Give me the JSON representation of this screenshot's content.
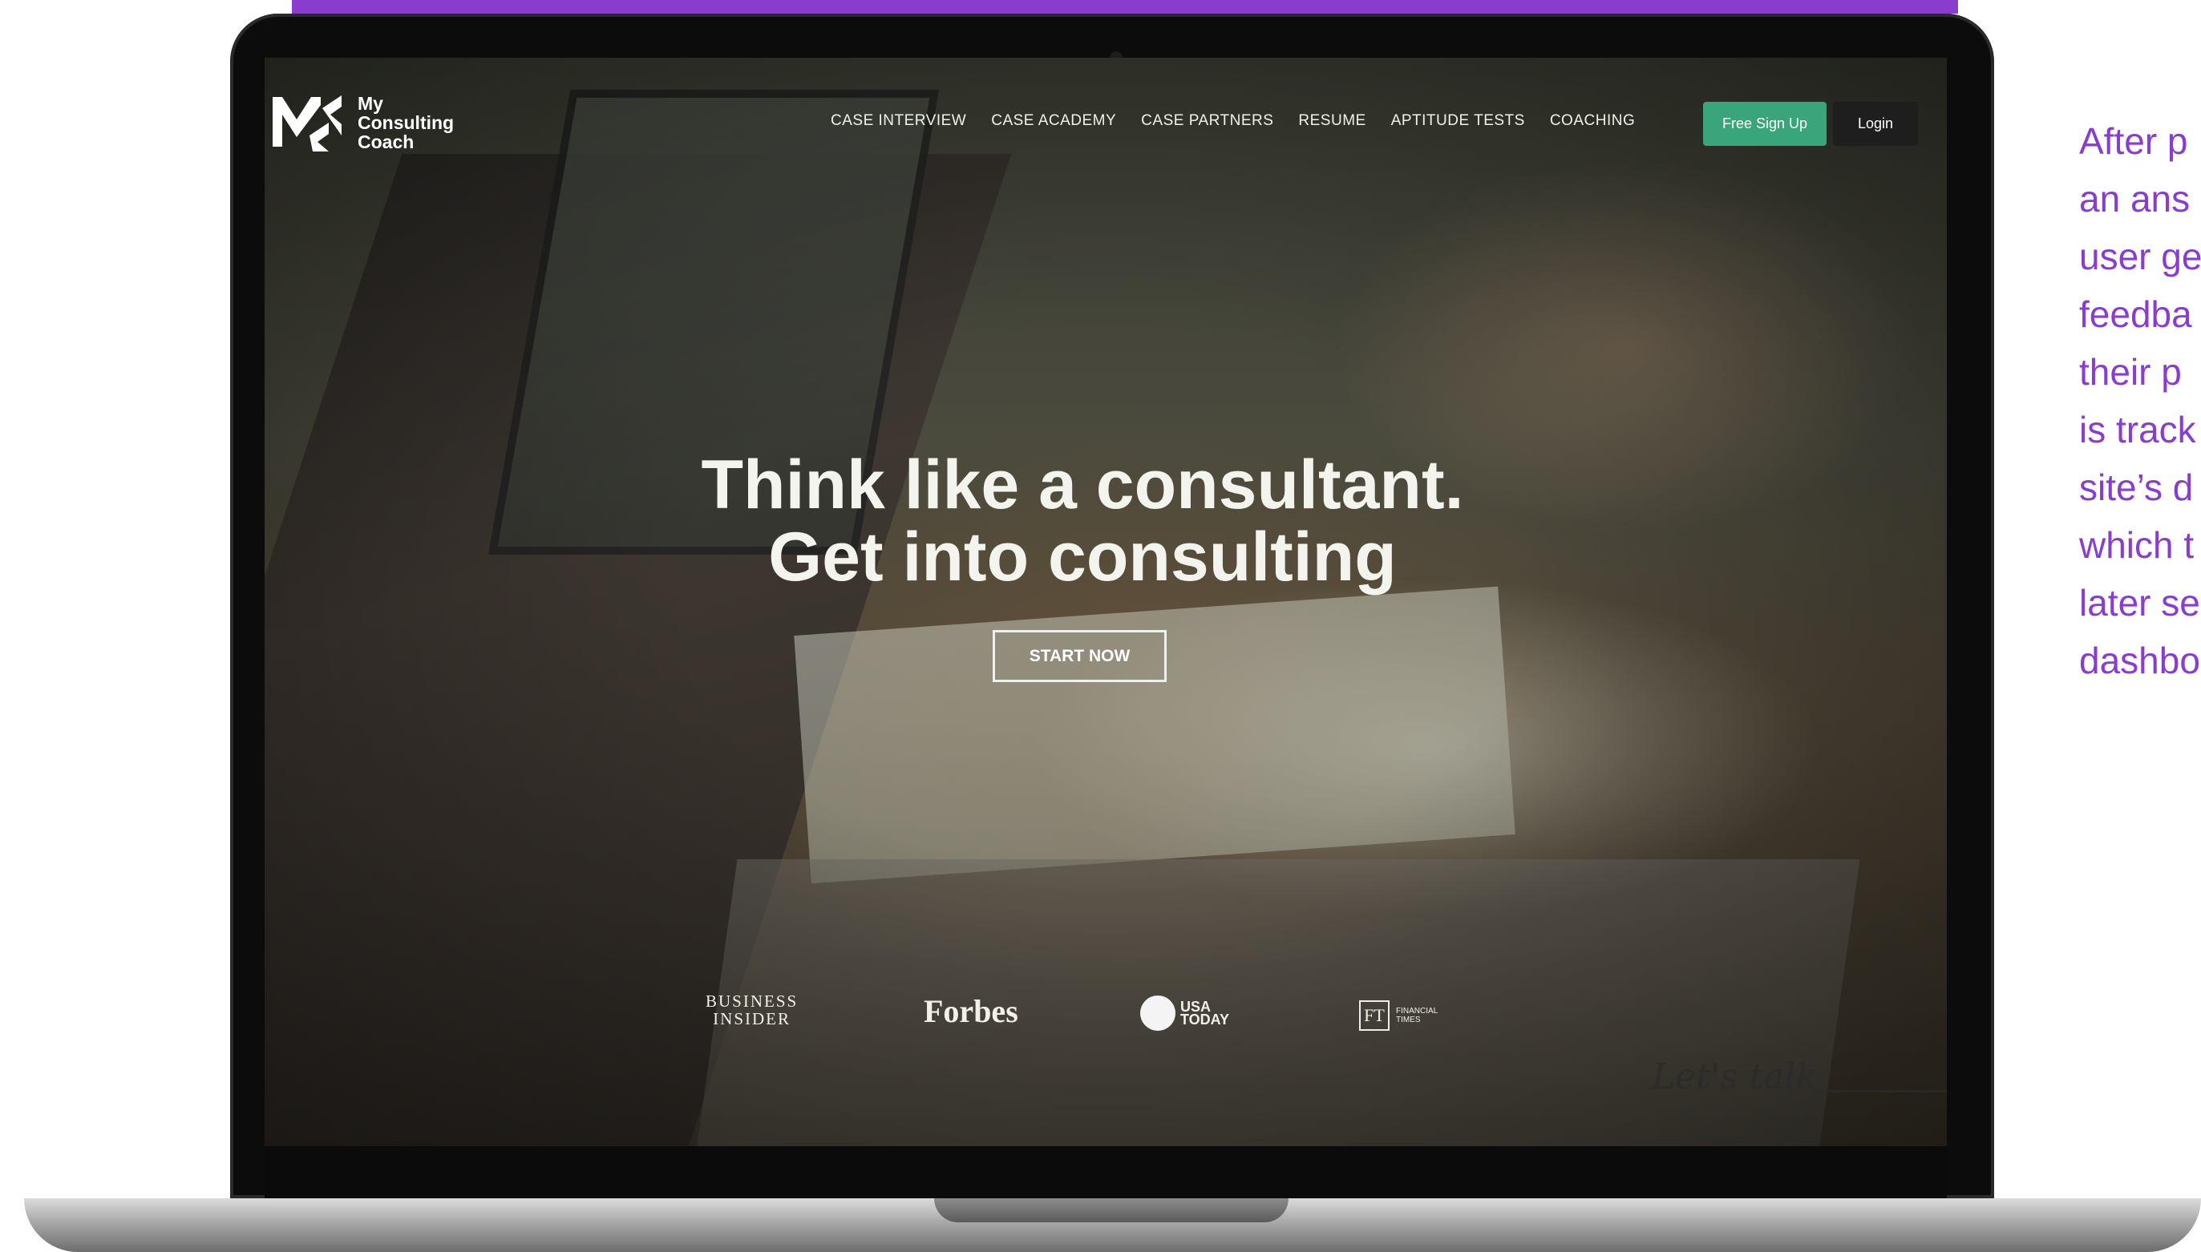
{
  "colors": {
    "accent_purple": "#8a3ccf",
    "signup_green": "#3aa57a",
    "login_dark": "#1e1e1e"
  },
  "site": {
    "logo_lines": [
      "My",
      "Consulting",
      "Coach"
    ],
    "nav": [
      "CASE INTERVIEW",
      "CASE ACADEMY",
      "CASE PARTNERS",
      "RESUME",
      "APTITUDE TESTS",
      "COACHING"
    ],
    "signup_label": "Free Sign Up",
    "login_label": "Login"
  },
  "hero": {
    "line1": "Think like a consultant.",
    "line2": "Get into consulting",
    "cta_label": "START NOW"
  },
  "press": {
    "business_insider": [
      "BUSINESS",
      "INSIDER"
    ],
    "forbes": "Forbes",
    "usa_today": [
      "USA",
      "TODAY"
    ],
    "ft_logo": "FT",
    "ft_text": "FINANCIAL TIMES"
  },
  "signature": "Let's talk",
  "side_text": [
    "After p",
    "an ans",
    "user ge",
    "feedba",
    "their p",
    "is track",
    "site’s d",
    "which t",
    "later se",
    "dashbo"
  ]
}
